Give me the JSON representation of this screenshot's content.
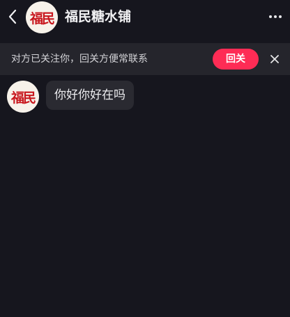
{
  "header": {
    "title": "福民糖水铺",
    "avatar_logo_text": "福民",
    "back_icon": "chevron-left-icon",
    "more_icon": "ellipsis-horizontal-icon"
  },
  "follow_bar": {
    "text": "对方已关注你，回关方便常联系",
    "button_label": "回关",
    "close_icon": "close-icon",
    "button_color": "#fe2c55"
  },
  "messages": [
    {
      "sender_logo_text": "福民",
      "text": "你好你好在吗"
    }
  ],
  "colors": {
    "background": "#16161e",
    "bar_background": "#25252c",
    "bubble_background": "#2a2a31",
    "logo_red": "#c8161d"
  }
}
